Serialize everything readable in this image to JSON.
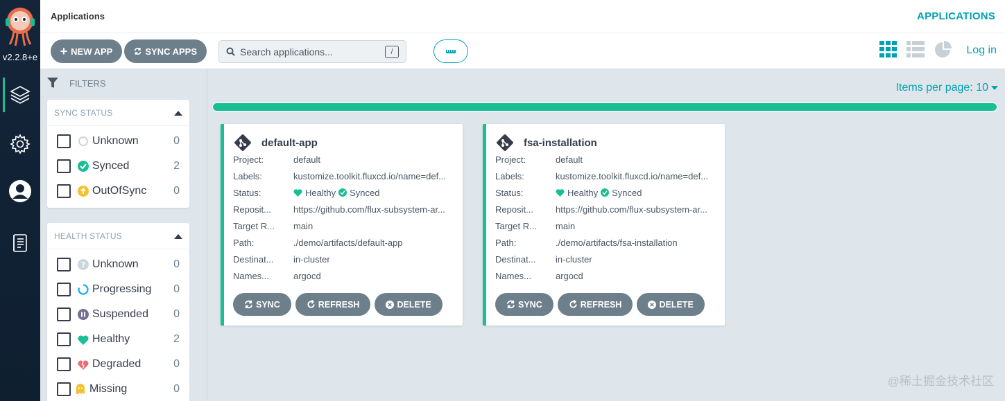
{
  "nav": {
    "version": "v2.2.8+e",
    "items": [
      {
        "icon": "layers-icon",
        "active": true
      },
      {
        "icon": "gear-icon",
        "active": false
      },
      {
        "icon": "user-icon",
        "active": false
      },
      {
        "icon": "docs-icon",
        "active": false
      }
    ]
  },
  "topbar": {
    "title": "Applications",
    "page_name": "APPLICATIONS"
  },
  "toolbar": {
    "new_app": "NEW APP",
    "sync_apps": "SYNC APPS",
    "search_placeholder": "Search applications...",
    "search_shortcut": "/",
    "login": "Log in"
  },
  "filters": {
    "title": "FILTERS",
    "sync_status": {
      "title": "SYNC STATUS",
      "items": [
        {
          "label": "Unknown",
          "count": "0"
        },
        {
          "label": "Synced",
          "count": "2"
        },
        {
          "label": "OutOfSync",
          "count": "0"
        }
      ]
    },
    "health_status": {
      "title": "HEALTH STATUS",
      "items": [
        {
          "label": "Unknown",
          "count": "0"
        },
        {
          "label": "Progressing",
          "count": "0"
        },
        {
          "label": "Suspended",
          "count": "0"
        },
        {
          "label": "Healthy",
          "count": "2"
        },
        {
          "label": "Degraded",
          "count": "0"
        },
        {
          "label": "Missing",
          "count": "0"
        }
      ]
    }
  },
  "content": {
    "items_per_page": "Items per page: 10",
    "progress": 1.0
  },
  "labels": {
    "project": "Project:",
    "labels": "Labels:",
    "status": "Status:",
    "repository": "Reposit...",
    "target_revision": "Target R...",
    "path": "Path:",
    "destination": "Destinat...",
    "namespace": "Names..."
  },
  "apps": [
    {
      "name": "default-app",
      "project": "default",
      "labels": "kustomize.toolkit.fluxcd.io/name=def...",
      "health": "Healthy",
      "sync": "Synced",
      "repository": "https://github.com/flux-subsystem-ar...",
      "target_revision": "main",
      "path": "./demo/artifacts/default-app",
      "destination": "in-cluster",
      "namespace": "argocd",
      "actions": {
        "sync": "SYNC",
        "refresh": "REFRESH",
        "delete": "DELETE"
      }
    },
    {
      "name": "fsa-installation",
      "project": "default",
      "labels": "kustomize.toolkit.fluxcd.io/name=def...",
      "health": "Healthy",
      "sync": "Synced",
      "repository": "https://github.com/flux-subsystem-ar...",
      "target_revision": "main",
      "path": "./demo/artifacts/fsa-installation",
      "destination": "in-cluster",
      "namespace": "argocd",
      "actions": {
        "sync": "SYNC",
        "refresh": "REFRESH",
        "delete": "DELETE"
      }
    }
  ],
  "watermark": "@稀土掘金技术社区",
  "colors": {
    "accent": "#00a2b3",
    "healthy": "#18be94",
    "button": "#6d7f8b",
    "nav_bg": "#14253a"
  }
}
